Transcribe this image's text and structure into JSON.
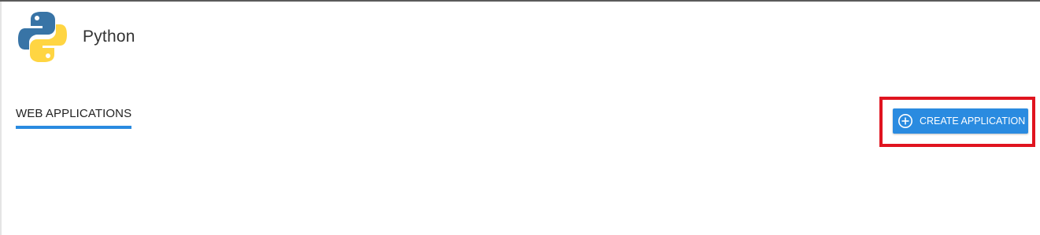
{
  "header": {
    "logo_icon": "python-logo",
    "title": "Python"
  },
  "tabs": [
    {
      "label": "WEB APPLICATIONS",
      "active": true
    }
  ],
  "actions": {
    "create_button_label": "CREATE APPLICATION",
    "create_button_icon": "plus-circle-icon",
    "highlighted": true
  },
  "colors": {
    "accent": "#2a8be0",
    "highlight": "#e0141f",
    "python_blue": "#3874a6",
    "python_yellow": "#ffd542"
  }
}
